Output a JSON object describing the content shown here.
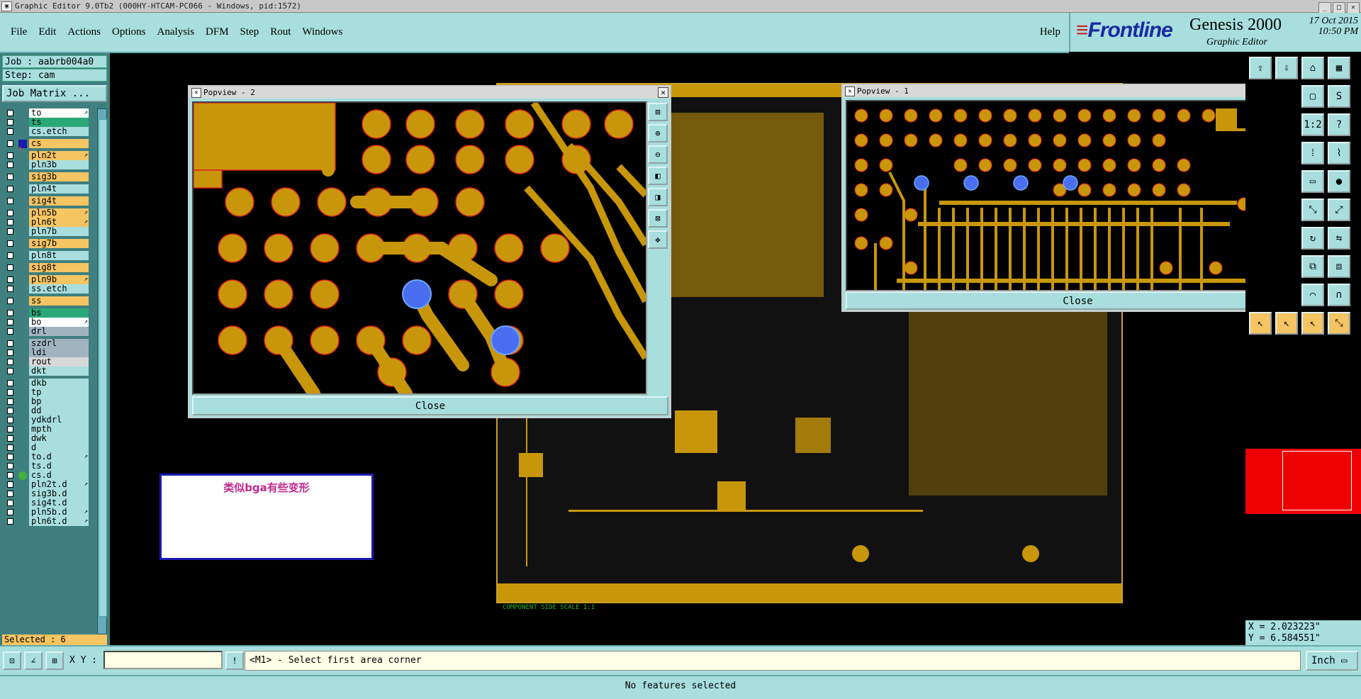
{
  "window": {
    "title": "Graphic Editor 9.0Tb2 (000HY-HTCAM-PC066 - Windows, pid:1572)"
  },
  "menu": {
    "items": [
      "File",
      "Edit",
      "Actions",
      "Options",
      "Analysis",
      "DFM",
      "Step",
      "Rout",
      "Windows"
    ],
    "help": "Help"
  },
  "brand": {
    "logo": "Frontline",
    "product": "Genesis 2000",
    "subtitle": "Graphic Editor",
    "date": "17 Oct 2015",
    "time": "10:50 PM"
  },
  "job": {
    "job_label": "Job : aabrb004a0",
    "step_label": "Step: cam",
    "matrix_button": "Job Matrix ..."
  },
  "layers": [
    {
      "name": "to",
      "color": "#ffffff",
      "arrow": true
    },
    {
      "name": "ts",
      "color": "#2aa878",
      "arrow": false
    },
    {
      "name": "cs.etch",
      "color": "#a8dede",
      "arrow": false
    },
    {
      "name": "cs",
      "color": "#f5c463",
      "arrow": false,
      "active": true
    },
    {
      "name": "pln2t",
      "color": "#f5c463",
      "arrow": true
    },
    {
      "name": "pln3b",
      "color": "#a8dede",
      "arrow": false
    },
    {
      "name": "sig3b",
      "color": "#f5c463",
      "arrow": false
    },
    {
      "name": "pln4t",
      "color": "#a8dede",
      "arrow": false
    },
    {
      "name": "sig4t",
      "color": "#f5c463",
      "arrow": false
    },
    {
      "name": "pln5b",
      "color": "#f5c463",
      "arrow": true
    },
    {
      "name": "pln6t",
      "color": "#f5c463",
      "arrow": true
    },
    {
      "name": "pln7b",
      "color": "#a8dede",
      "arrow": false
    },
    {
      "name": "sig7b",
      "color": "#f5c463",
      "arrow": false
    },
    {
      "name": "pln8t",
      "color": "#a8dede",
      "arrow": false
    },
    {
      "name": "sig8t",
      "color": "#f5c463",
      "arrow": false
    },
    {
      "name": "pln9b",
      "color": "#f5c463",
      "arrow": true
    },
    {
      "name": "ss.etch",
      "color": "#a8dede",
      "arrow": false
    },
    {
      "name": "ss",
      "color": "#f5c463",
      "arrow": false
    },
    {
      "name": "bs",
      "color": "#2aa878",
      "arrow": false
    },
    {
      "name": "bo",
      "color": "#ffffff",
      "arrow": true
    },
    {
      "name": "drl",
      "color": "#a0b4c0",
      "arrow": false
    },
    {
      "name": "szdrl",
      "color": "#a0b4c0",
      "arrow": false
    },
    {
      "name": "ldi",
      "color": "#a0b4c0",
      "arrow": false
    },
    {
      "name": "rout",
      "color": "#d8d8d8",
      "arrow": false
    },
    {
      "name": "dkt",
      "color": "#a8dede",
      "arrow": false
    },
    {
      "name": "dkb",
      "color": "#a8dede",
      "arrow": false
    },
    {
      "name": "tp",
      "color": "#a8dede",
      "arrow": false
    },
    {
      "name": "bp",
      "color": "#a8dede",
      "arrow": false
    },
    {
      "name": "dd",
      "color": "#a8dede",
      "arrow": false
    },
    {
      "name": "ydkdrl",
      "color": "#a8dede",
      "arrow": false
    },
    {
      "name": "mpth",
      "color": "#a8dede",
      "arrow": false
    },
    {
      "name": "dwk",
      "color": "#a8dede",
      "arrow": false
    },
    {
      "name": "d",
      "color": "#a8dede",
      "arrow": false
    },
    {
      "name": "to.d",
      "color": "#a8dede",
      "arrow": true
    },
    {
      "name": "ts.d",
      "color": "#a8dede",
      "arrow": false
    },
    {
      "name": "cs.d",
      "color": "#a8dede",
      "arrow": false,
      "dot": true
    },
    {
      "name": "pln2t.d",
      "color": "#a8dede",
      "arrow": true
    },
    {
      "name": "sig3b.d",
      "color": "#a8dede",
      "arrow": false
    },
    {
      "name": "sig4t.d",
      "color": "#a8dede",
      "arrow": false
    },
    {
      "name": "pln5b.d",
      "color": "#a8dede",
      "arrow": true
    },
    {
      "name": "pln6t.d",
      "color": "#a8dede",
      "arrow": true
    }
  ],
  "selected_count": "Selected : 6",
  "note": {
    "text": "类似bga有些变形"
  },
  "canvas": {
    "scale_label": "COMPONENT SIDE SCALE 1:1"
  },
  "popview2": {
    "title": "Popview - 2",
    "close_label": "Close"
  },
  "popview1": {
    "title": "Popview - 1",
    "close_label": "Close"
  },
  "coords": {
    "x": "X = 2.023223\"",
    "y": "Y = 6.584551\""
  },
  "cmd": {
    "xy_label": "X Y :",
    "xy_value": "",
    "prompt": "<M1> - Select first area corner",
    "unit": "Inch"
  },
  "status": {
    "message": "No features selected"
  },
  "colors": {
    "panel": "#a8dede",
    "copper": "#c8960a",
    "highlight": "#f5c463",
    "selected_pad": "#4a6ef0"
  }
}
